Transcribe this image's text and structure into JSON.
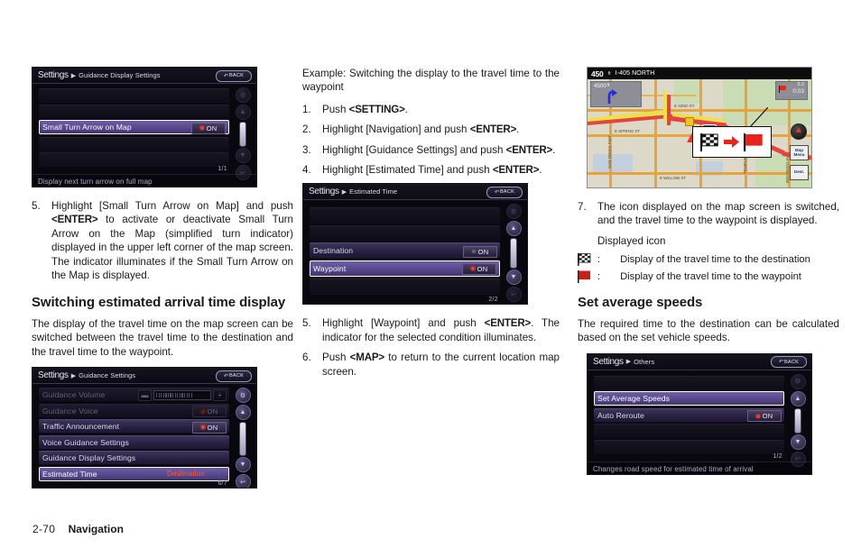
{
  "footer": {
    "page_number": "2-70",
    "section": "Navigation"
  },
  "left_column": {
    "screen1": {
      "title": "Settings",
      "breadcrumb": "Guidance Display Settings",
      "back_label": "BACK",
      "rows": [
        {
          "label": "",
          "type": "empty"
        },
        {
          "label": "",
          "type": "empty"
        },
        {
          "label": "Small Turn Arrow on Map",
          "type": "selected",
          "toggle": "ON",
          "toggle_state": "on"
        },
        {
          "label": "",
          "type": "empty"
        },
        {
          "label": "",
          "type": "empty"
        }
      ],
      "page_indicator": "1/1",
      "status_text": "Display next turn arrow on full map"
    },
    "step5": {
      "number": "5.",
      "text_a": "Highlight [Small Turn Arrow on Map] and push ",
      "kbd": "<ENTER>",
      "text_b": " to activate or deactivate Small Turn Arrow on the Map (simplified turn indicator) displayed in the upper left corner of the map screen. The indicator illuminates if the Small Turn Arrow on the Map is displayed."
    },
    "heading": "Switching estimated arrival time display",
    "intro": "The display of the travel time on the map screen can be switched between the travel time to the destination and the travel time to the waypoint.",
    "screen2": {
      "title": "Settings",
      "breadcrumb": "Guidance Settings",
      "back_label": "BACK",
      "rows": [
        {
          "label": "Guidance Volume",
          "type": "slider",
          "dim": true
        },
        {
          "label": "Guidance Voice",
          "type": "normal",
          "toggle": "ON",
          "toggle_state": "on",
          "dim": true
        },
        {
          "label": "Traffic Announcement",
          "type": "normal",
          "toggle": "ON",
          "toggle_state": "on"
        },
        {
          "label": "Voice Guidance Settings",
          "type": "normal"
        },
        {
          "label": "Guidance Display Settings",
          "type": "normal"
        },
        {
          "label": "Estimated Time",
          "type": "selected",
          "value": "Destination"
        }
      ],
      "page_indicator": "6/7"
    }
  },
  "mid_column": {
    "example_intro": "Example: Switching the display to the travel time to the waypoint",
    "steps": [
      {
        "num": "1.",
        "pre": "Push ",
        "kbd": "<SETTING>",
        "post": "."
      },
      {
        "num": "2.",
        "pre": "Highlight [Navigation] and push ",
        "kbd": "<ENTER>",
        "post": "."
      },
      {
        "num": "3.",
        "pre": "Highlight [Guidance Settings] and push ",
        "kbd": "<ENTER>",
        "post": "."
      },
      {
        "num": "4.",
        "pre": "Highlight [Estimated Time] and push ",
        "kbd": "<ENTER>",
        "post": "."
      }
    ],
    "screen3": {
      "title": "Settings",
      "breadcrumb": "Estimated Time",
      "back_label": "BACK",
      "rows": [
        {
          "label": "",
          "type": "empty"
        },
        {
          "label": "",
          "type": "empty"
        },
        {
          "label": "Destination",
          "type": "normal",
          "toggle": "ON",
          "toggle_state": "off"
        },
        {
          "label": "Waypoint",
          "type": "selected",
          "toggle": "ON",
          "toggle_state": "on"
        },
        {
          "label": "",
          "type": "empty"
        }
      ],
      "page_indicator": "2/2"
    },
    "steps2": [
      {
        "num": "5.",
        "pre": "Highlight [Waypoint] and push ",
        "kbd": "<ENTER>",
        "post": ". The indicator for the selected condition illuminates."
      },
      {
        "num": "6.",
        "pre": "Push ",
        "kbd": "<MAP>",
        "post": " to return to the current location map screen."
      }
    ]
  },
  "right_column": {
    "map": {
      "distance": "450",
      "distance_unit": "ft",
      "road_name": "I-405 NORTH",
      "sub_distance": "4500",
      "sub_unit": "ft",
      "eta_line1": "3.2",
      "eta_unit": "mi",
      "eta_line2": "0:03",
      "street_labels": [
        "E 32ND ST",
        "E SPRING ST",
        "E WILLOW ST",
        "I-405"
      ],
      "vertical_labels": [
        "SAN DIEGO FWY",
        "TEMPLE AV",
        "REDONDO AV"
      ],
      "map_menu_button": "Map Menu",
      "dest_button": "Dest."
    },
    "step7": {
      "num": "7.",
      "text": "The icon displayed on the map screen is switched, and the travel time to the waypoint is displayed."
    },
    "displayed_icon_label": "Displayed icon",
    "icon_rows": [
      {
        "icon": "checkered-flag-icon",
        "colon": ":",
        "desc": "Display of the travel time to the destination"
      },
      {
        "icon": "red-flag-icon",
        "colon": ":",
        "desc": "Display of the travel time to the waypoint"
      }
    ],
    "heading": "Set average speeds",
    "intro": "The required time to the destination can be calculated based on the set vehicle speeds.",
    "screen4": {
      "title": "Settings",
      "breadcrumb": "Others",
      "back_label": "BACK",
      "rows": [
        {
          "label": "",
          "type": "empty"
        },
        {
          "label": "Set Average Speeds",
          "type": "selected"
        },
        {
          "label": "Auto Reroute",
          "type": "normal",
          "toggle": "ON",
          "toggle_state": "on"
        },
        {
          "label": "",
          "type": "empty"
        },
        {
          "label": "",
          "type": "empty"
        }
      ],
      "page_indicator": "1/2",
      "status_text": "Changes road speed for estimated time of arrival"
    }
  },
  "colors": {
    "accent_purple": "#6f5fa6",
    "indicator_red": "#ff3a1e",
    "value_orange": "#ff5a3c",
    "screen_bg": "#09080f"
  }
}
